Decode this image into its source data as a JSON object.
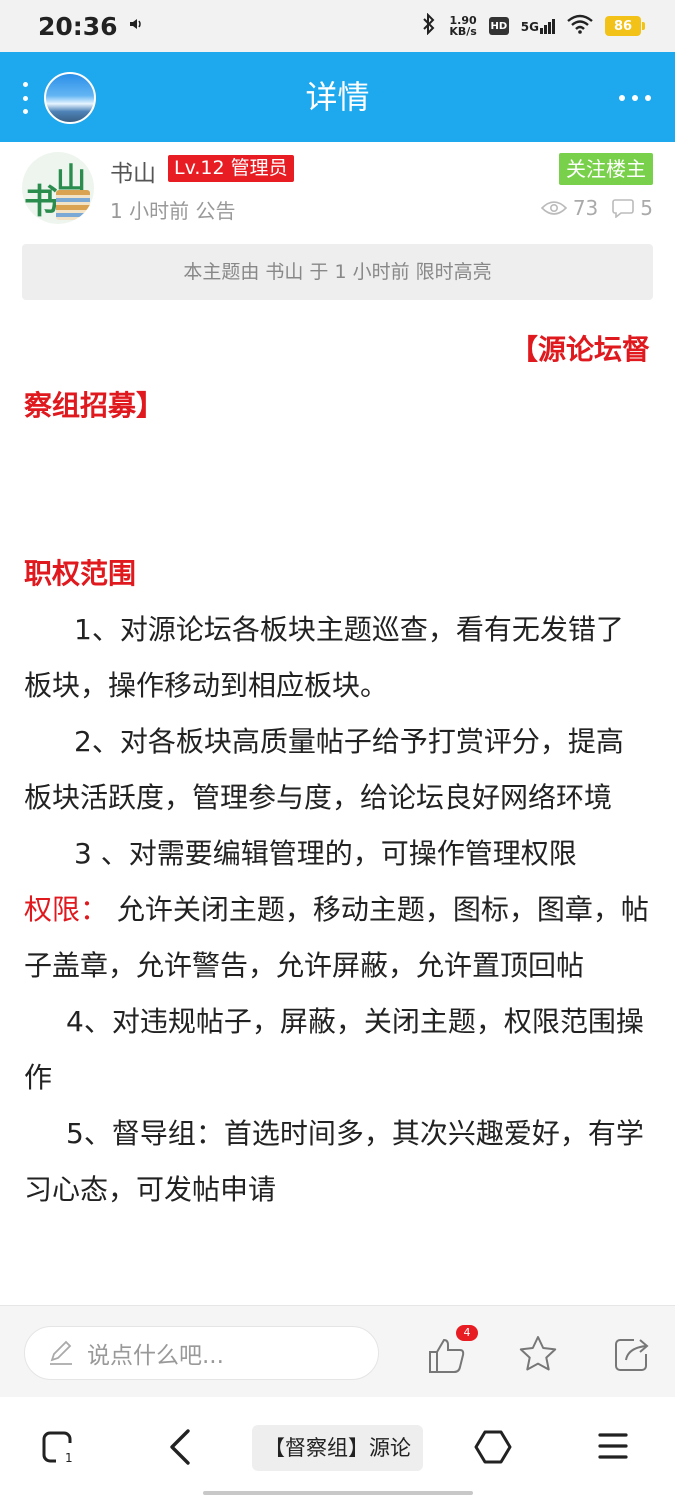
{
  "status_bar": {
    "time": "20:36",
    "network_speed_value": "1.90",
    "network_speed_unit": "KB/s",
    "hd_label": "HD",
    "signal_label": "5G",
    "battery": "86"
  },
  "app_bar": {
    "title": "详情"
  },
  "author": {
    "name": "书山",
    "level": "Lv.12 管理员",
    "meta": "1 小时前 公告",
    "follow_label": "关注楼主",
    "views": "73",
    "comments": "5",
    "avatar_chars": [
      "书",
      "山"
    ]
  },
  "notice": "本主题由 书山 于 1 小时前 限时高亮",
  "content": {
    "heading_part1": "【源论坛督",
    "heading_part2": "察组招募】",
    "section_title": "职权范围",
    "item1": "1、对源论坛各板块主题巡查，看有无发错了板块，操作移动到相应板块。",
    "item2": "2、对各板块高质量帖子给予打赏评分，提高板块活跃度，管理参与度，给论坛良好网络环境",
    "item3": "3 、对需要编辑管理的，可操作管理权限",
    "perm_label": "权限：",
    "perm_text": " 允许关闭主题，移动主题，图标，图章，帖子盖章，允许警告，允许屏蔽，允许置顶回帖",
    "item4": "4、对违规帖子，屏蔽，关闭主题，权限范围操作",
    "item5": "5、督导组：首选时间多，其次兴趣爱好，有学习心态，可发帖申请"
  },
  "reply_bar": {
    "placeholder": "说点什么吧...",
    "like_count": "4"
  },
  "nav_bar": {
    "tab_count": "1",
    "page_title": "【督察组】源论"
  },
  "colors": {
    "app_bar": "#1ea8ee",
    "accent_red": "#e0191e",
    "follow_green": "#79d14b",
    "battery_yellow": "#f2c219"
  },
  "icons": {
    "sound": "volume-icon",
    "bluetooth": "bluetooth-icon",
    "wifi": "wifi-icon",
    "views": "eye-icon",
    "comments": "comment-icon",
    "reply": "pencil-icon",
    "like": "thumbs-up-icon",
    "favorite": "star-icon",
    "share": "share-icon",
    "tabs": "tabs-icon",
    "back": "back-chevron-icon",
    "home": "home-icon",
    "menu": "hamburger-menu-icon"
  }
}
